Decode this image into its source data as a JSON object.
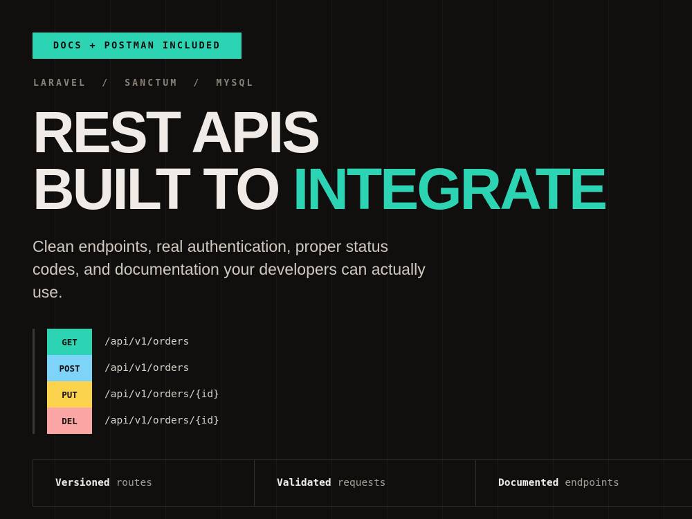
{
  "badge": "DOCS + POSTMAN INCLUDED",
  "stack": {
    "items": [
      "LARAVEL",
      "SANCTUM",
      "MYSQL"
    ],
    "separator": "/"
  },
  "headline": {
    "line1": "REST APIS",
    "line2_plain": "BUILT TO",
    "line2_accent": "INTEGRATE"
  },
  "lede": "Clean endpoints, real authentication, proper status codes, and documentation your developers can actually use.",
  "endpoints": [
    {
      "method": "GET",
      "path": "/api/v1/orders",
      "color": "#2dd4b4"
    },
    {
      "method": "POST",
      "path": "/api/v1/orders",
      "color": "#7dd3f8"
    },
    {
      "method": "PUT",
      "path": "/api/v1/orders/{id}",
      "color": "#fcd34d"
    },
    {
      "method": "DEL",
      "path": "/api/v1/orders/{id}",
      "color": "#fca5a5"
    }
  ],
  "features": [
    {
      "strong": "Versioned",
      "rest": "routes"
    },
    {
      "strong": "Validated",
      "rest": "requests"
    },
    {
      "strong": "Documented",
      "rest": "endpoints"
    }
  ],
  "colors": {
    "background": "#110f0e",
    "accent": "#2dd4b4",
    "text": "#f0ebe6",
    "muted": "#8a8379"
  }
}
